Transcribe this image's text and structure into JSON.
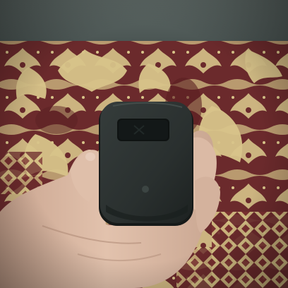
{
  "scene": {
    "description_subject": "pocket-wifi-router-in-hand",
    "colors": {
      "wall": "#586360",
      "carpet_base": "#6b2a2c",
      "carpet_pattern": "#d8c48a",
      "carpet_accent": "#a06b4a",
      "device_body": "#2b3130",
      "device_edge": "#1c2120",
      "device_screen": "#101413",
      "skin": "#d9b8a2",
      "skin_shadow": "#b58f7c"
    }
  }
}
